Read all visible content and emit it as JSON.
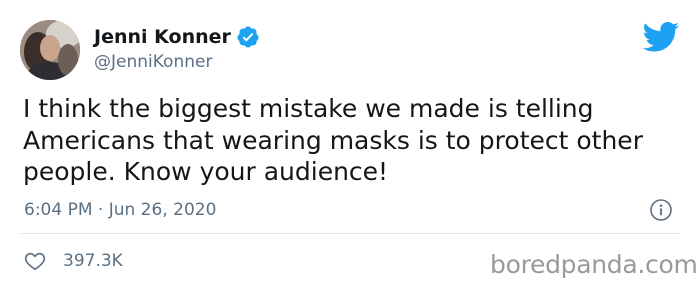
{
  "author": {
    "display_name": "Jenni Konner",
    "handle": "@JenniKonner",
    "verified": true
  },
  "tweet": {
    "text": "I think the biggest mistake we made is telling Americans that wearing masks is to protect other people. Know your audience!",
    "time": "6:04 PM",
    "separator": "·",
    "date": "Jun 26, 2020"
  },
  "engagement": {
    "likes": "397.3K"
  },
  "watermark": "boredpanda.com",
  "icons": {
    "verified": "verified-badge-icon",
    "twitter": "twitter-bird-icon",
    "info": "info-icon",
    "like": "heart-icon"
  },
  "colors": {
    "twitter_blue": "#1da1f2",
    "text": "#14171a",
    "secondary": "#5b7083",
    "divider": "#e1e8ed",
    "watermark": "#9a9a9a"
  }
}
